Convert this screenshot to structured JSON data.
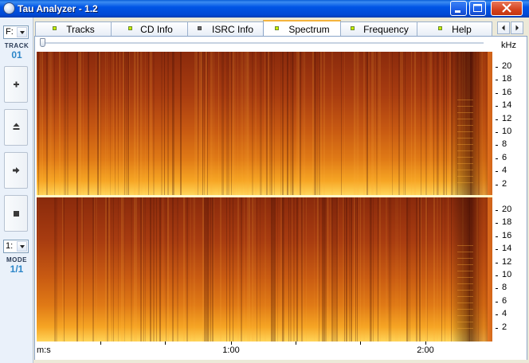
{
  "window": {
    "title": "Tau Analyzer - 1.2"
  },
  "left_panel": {
    "drive_select": "F:",
    "track_label": "TRACK",
    "track_value": "01",
    "mode_select": "1:",
    "mode_label": "MODE",
    "mode_value": "1/1",
    "buttons": [
      "add-icon",
      "eject-icon",
      "play-icon",
      "stop-icon"
    ]
  },
  "tabs": [
    {
      "label": "Tracks",
      "led": "green"
    },
    {
      "label": "CD Info",
      "led": "green"
    },
    {
      "label": "ISRC Info",
      "led": "grey"
    },
    {
      "label": "Spectrum",
      "led": "green",
      "active": true
    },
    {
      "label": "Frequency",
      "led": "green"
    },
    {
      "label": "Help",
      "led": "green"
    }
  ],
  "spectrum": {
    "y_unit": "kHz",
    "y_ticks": [
      "20",
      "18",
      "16",
      "14",
      "12",
      "10",
      "8",
      "6",
      "4",
      "2"
    ],
    "x_unit": "m:s",
    "x_labels": [
      "1:00",
      "2:00"
    ],
    "channels": 2,
    "colors": {
      "high": "#ffe47a",
      "mid": "#f08a1a",
      "low": "#7a1e0c",
      "dark": "#3a0a04",
      "separator": "#fff7c8"
    }
  }
}
